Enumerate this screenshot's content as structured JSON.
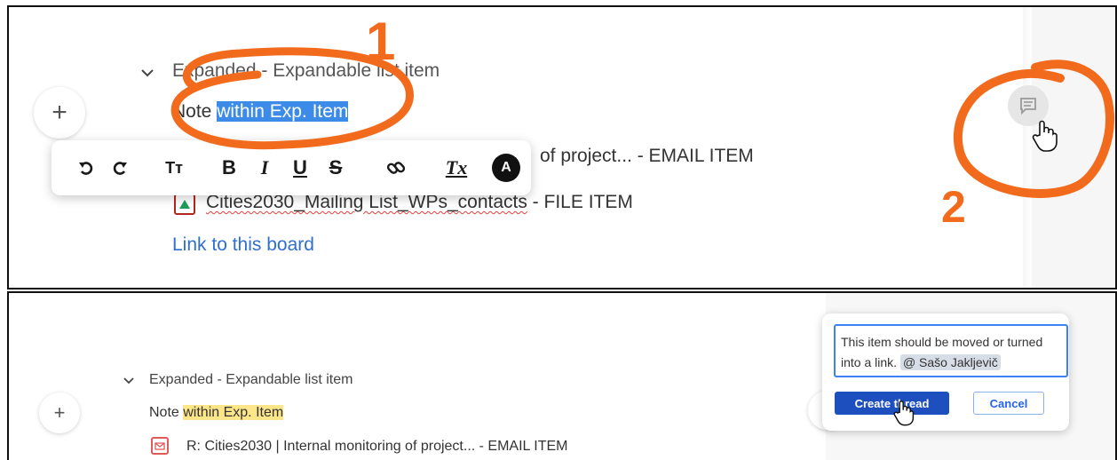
{
  "top": {
    "expanded_item": {
      "label": "Expanded - Expandable list item"
    },
    "note": {
      "prefix": "Note ",
      "highlight": "within Exp. Item"
    },
    "email_item_partial": "of project... - EMAIL ITEM",
    "file_item": {
      "name": "Cities2030_Mailing List_WPs_contacts",
      "suffix": " - FILE ITEM"
    },
    "link": "Link to this board",
    "add_button": "+",
    "toolbar": {
      "undo": "undo-icon",
      "redo": "redo-icon",
      "text_size": "Tт",
      "bold": "B",
      "italic": "I",
      "underline": "U",
      "strike": "S",
      "link": "link-icon",
      "clear": "Tx",
      "color": "A"
    },
    "annotation_1": "1",
    "annotation_2": "2"
  },
  "bottom": {
    "expanded_item": {
      "label": "Expanded - Expandable list item"
    },
    "note": {
      "prefix": "Note ",
      "highlight": "within Exp. Item"
    },
    "email_item": "R: Cities2030 | Internal monitoring of project... - EMAIL ITEM",
    "add_button": "+",
    "comment": {
      "text": "This item should be moved or turned into a link.",
      "mention": "@ Sašo Jakljevič",
      "create_label": "Create thread",
      "cancel_label": "Cancel"
    }
  },
  "colors": {
    "annotation": "#f26b1d",
    "selection": "#3d8be8",
    "highlight_yellow": "#fde68a",
    "link": "#2f6fd0",
    "primary_button": "#1d4fbf"
  }
}
